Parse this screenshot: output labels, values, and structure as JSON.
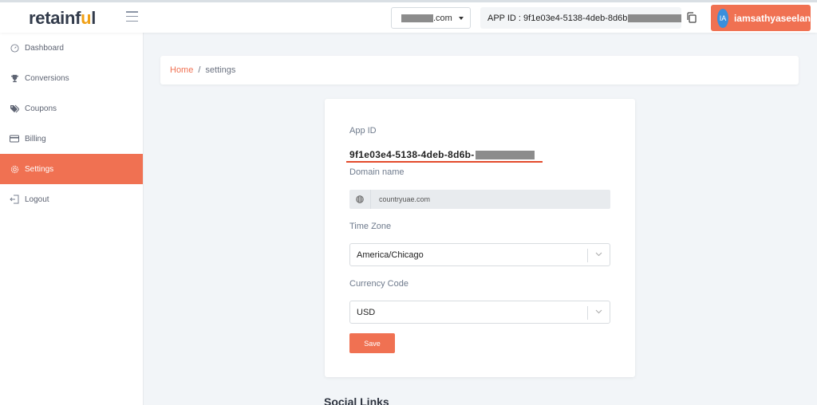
{
  "header": {
    "logo_text_main": "retainf",
    "logo_text_accent": "u",
    "logo_text_end": "l",
    "domain_select_suffix": ".com",
    "app_id_label": "APP ID : 9f1e03e4-5138-4deb-8d6b",
    "user_initials": "IA",
    "user_name": "iamsathyaseelan"
  },
  "sidebar": {
    "items": [
      {
        "label": "Dashboard",
        "icon": "dashboard-gauge-icon",
        "active": false
      },
      {
        "label": "Conversions",
        "icon": "trophy-icon",
        "active": false
      },
      {
        "label": "Coupons",
        "icon": "tags-icon",
        "active": false
      },
      {
        "label": "Billing",
        "icon": "credit-card-icon",
        "active": false
      },
      {
        "label": "Settings",
        "icon": "gear-icon",
        "active": true
      },
      {
        "label": "Logout",
        "icon": "logout-icon",
        "active": false
      }
    ]
  },
  "breadcrumb": {
    "home": "Home",
    "separator": "/",
    "current": "settings"
  },
  "form": {
    "app_id_label": "App ID",
    "app_id_value": "9f1e03e4-5138-4deb-8d6b-",
    "domain_label": "Domain name",
    "domain_value": "countryuae.com",
    "timezone_label": "Time Zone",
    "timezone_value": "America/Chicago",
    "currency_label": "Currency Code",
    "currency_value": "USD",
    "save_label": "Save"
  },
  "social_links_heading": "Social Links",
  "colors": {
    "accent": "#f07152",
    "avatar": "#3a8fdc",
    "underline": "#e34b2b"
  }
}
